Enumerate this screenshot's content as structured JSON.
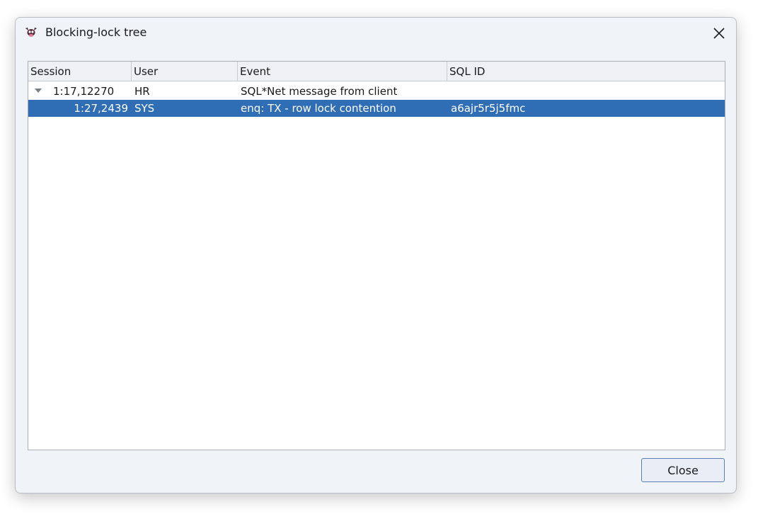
{
  "window": {
    "title": "Blocking-lock tree",
    "icon": "cow-app-icon",
    "close_icon": "close-icon"
  },
  "grid": {
    "columns": [
      "Session",
      "User",
      "Event",
      "SQL ID"
    ],
    "rows": [
      {
        "expanded": true,
        "session": "1:17,12270",
        "user": "HR",
        "event": "SQL*Net message from client",
        "sql_id": ""
      },
      {
        "selected": true,
        "session": "1:27,2439",
        "user": "SYS",
        "event": "enq: TX - row lock contention",
        "sql_id": "a6ajr5r5j5fmc"
      }
    ]
  },
  "buttons": {
    "close_label": "Close"
  },
  "colors": {
    "selection": "#2f6db5",
    "button_border": "#5a7fb2"
  }
}
